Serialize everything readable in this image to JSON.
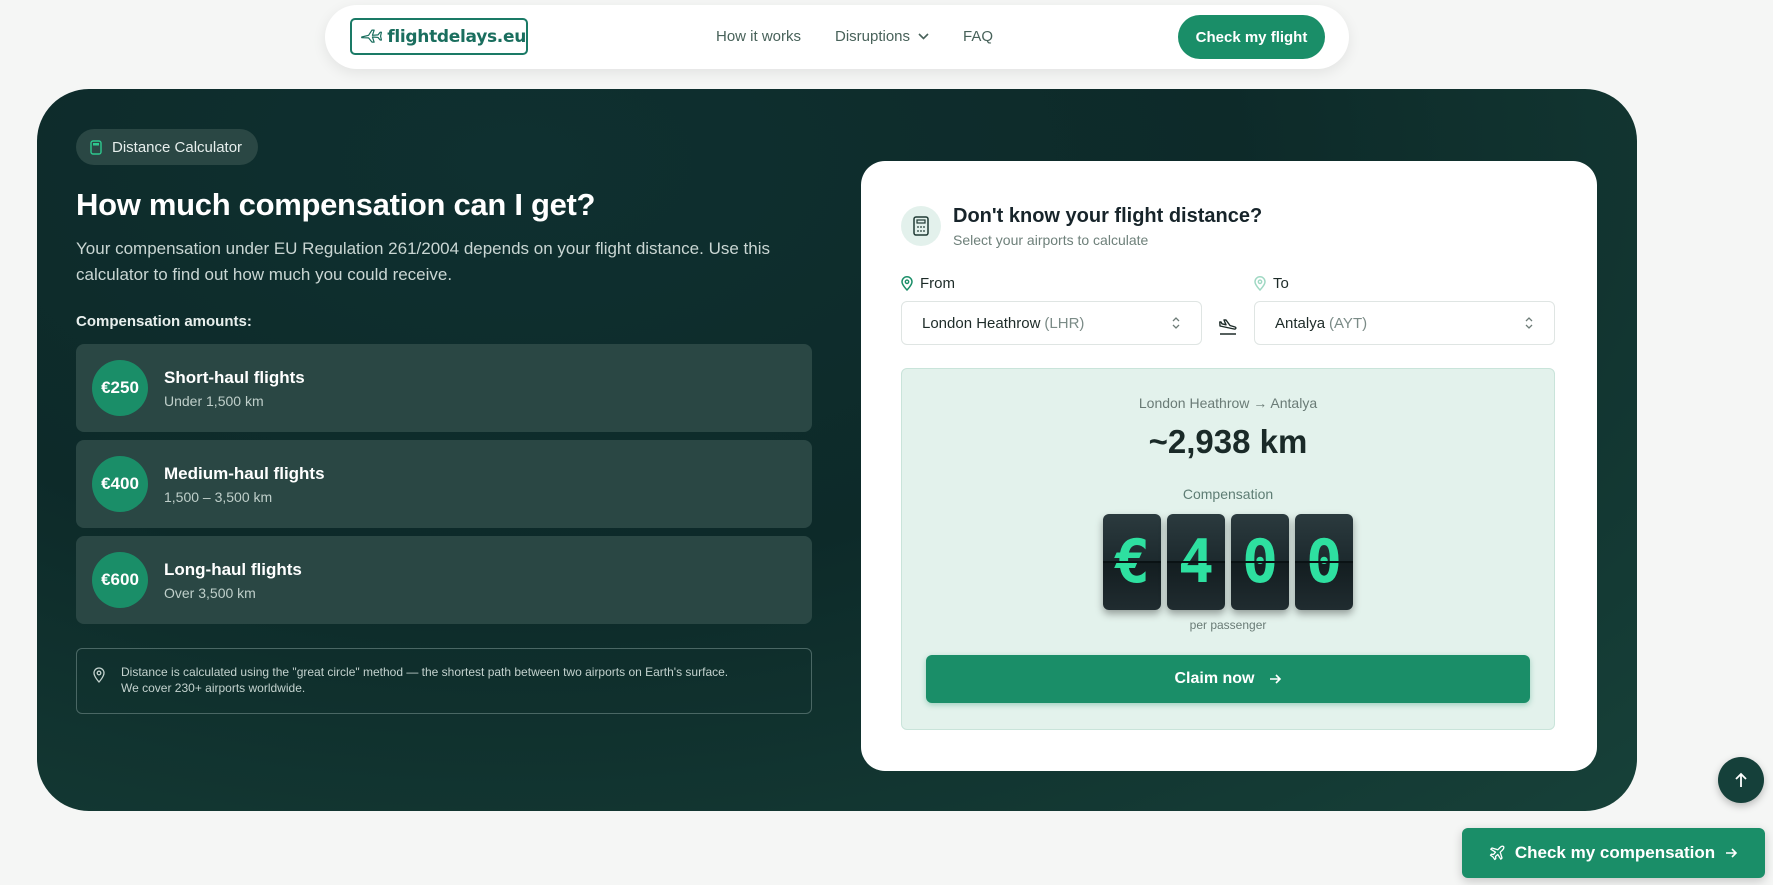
{
  "nav": {
    "logo_text": "flightdelays.eu",
    "links": [
      "How it works",
      "Disruptions",
      "FAQ"
    ],
    "cta": "Check my flight"
  },
  "hero": {
    "badge": "Distance Calculator",
    "title": "How much compensation can I get?",
    "description": "Your compensation under EU Regulation 261/2004 depends on your flight distance. Use this calculator to find out how much you could receive.",
    "amounts_label": "Compensation amounts:",
    "tiers": [
      {
        "amount": "€250",
        "name": "Short-haul flights",
        "range": "Under 1,500 km"
      },
      {
        "amount": "€400",
        "name": "Medium-haul flights",
        "range": "1,500 – 3,500 km"
      },
      {
        "amount": "€600",
        "name": "Long-haul flights",
        "range": "Over 3,500 km"
      }
    ],
    "note_line1": "Distance is calculated using the \"great circle\" method — the shortest path between two airports on Earth's surface.",
    "note_line2": "We cover 230+ airports worldwide."
  },
  "calculator": {
    "title": "Don't know your flight distance?",
    "subtitle": "Select your airports to calculate",
    "from_label": "From",
    "to_label": "To",
    "from_airport": "London Heathrow",
    "from_code": "(LHR)",
    "to_airport": "Antalya",
    "to_code": "(AYT)",
    "route": "London Heathrow → Antalya",
    "distance": "~2,938 km",
    "compensation_label": "Compensation",
    "digits": [
      "€",
      "4",
      "0",
      "0"
    ],
    "per_passenger": "per passenger",
    "claim_button": "Claim now"
  },
  "floating_cta": "Check my compensation",
  "colors": {
    "brand_green": "#1a8e68",
    "hero_dark": "#0d2a29",
    "digit_green": "#2ee0a0"
  }
}
